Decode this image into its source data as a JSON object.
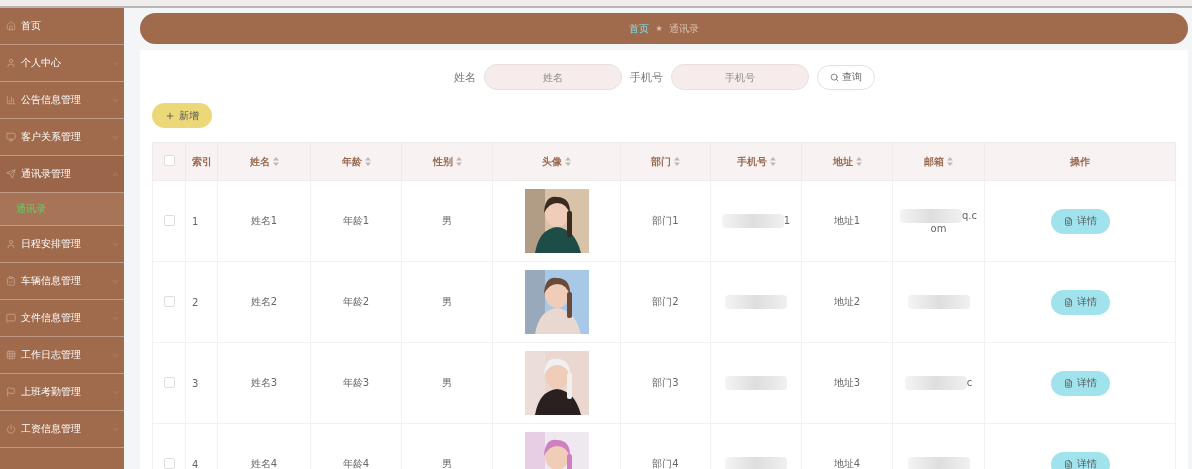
{
  "sidebar": {
    "items": [
      {
        "label": "首页",
        "expandable": false
      },
      {
        "label": "个人中心",
        "expandable": true,
        "expanded": false
      },
      {
        "label": "公告信息管理",
        "expandable": true,
        "expanded": false
      },
      {
        "label": "客户关系管理",
        "expandable": true,
        "expanded": false
      },
      {
        "label": "通讯录管理",
        "expandable": true,
        "expanded": true,
        "children": [
          {
            "label": "通讯录",
            "selected": true
          }
        ]
      },
      {
        "label": "日程安排管理",
        "expandable": true,
        "expanded": false
      },
      {
        "label": "车辆信息管理",
        "expandable": true,
        "expanded": false
      },
      {
        "label": "文件信息管理",
        "expandable": true,
        "expanded": false
      },
      {
        "label": "工作日志管理",
        "expandable": true,
        "expanded": false
      },
      {
        "label": "上班考勤管理",
        "expandable": true,
        "expanded": false
      },
      {
        "label": "工资信息管理",
        "expandable": true,
        "expanded": false
      }
    ]
  },
  "breadcrumb": {
    "items": [
      {
        "label": "首页",
        "selected": false
      },
      {
        "label": "通讯录",
        "selected": true
      }
    ],
    "separator": "★"
  },
  "search": {
    "fields": [
      {
        "label": "姓名",
        "placeholder": "姓名"
      },
      {
        "label": "手机号",
        "placeholder": "手机号"
      }
    ],
    "button": "查询"
  },
  "add_button": "新增",
  "table": {
    "all_checked": false,
    "columns": [
      {
        "label": "索引",
        "sortable": false
      },
      {
        "label": "姓名",
        "sortable": true
      },
      {
        "label": "年龄",
        "sortable": true
      },
      {
        "label": "性别",
        "sortable": true
      },
      {
        "label": "头像",
        "sortable": true
      },
      {
        "label": "部门",
        "sortable": true
      },
      {
        "label": "手机号",
        "sortable": true
      },
      {
        "label": "地址",
        "sortable": true
      },
      {
        "label": "邮箱",
        "sortable": true
      },
      {
        "label": "操作",
        "sortable": false
      }
    ],
    "rows": [
      {
        "checked": false,
        "index": "1",
        "name": "姓名1",
        "age": "年龄1",
        "gender": "男",
        "department": "部门1",
        "phone": "1",
        "address": "地址1",
        "email": "q.c",
        "email_2": "om",
        "action": "详情"
      },
      {
        "checked": false,
        "index": "2",
        "name": "姓名2",
        "age": "年龄2",
        "gender": "男",
        "department": "部门2",
        "address": "地址2",
        "action": "详情"
      },
      {
        "checked": false,
        "index": "3",
        "name": "姓名3",
        "age": "年龄3",
        "gender": "男",
        "department": "部门3",
        "address": "地址3",
        "email": "c",
        "action": "详情"
      },
      {
        "checked": false,
        "index": "4",
        "name": "姓名4",
        "age": "年龄4",
        "gender": "男",
        "department": "部门4",
        "address": "地址4",
        "action": "详情"
      }
    ]
  }
}
